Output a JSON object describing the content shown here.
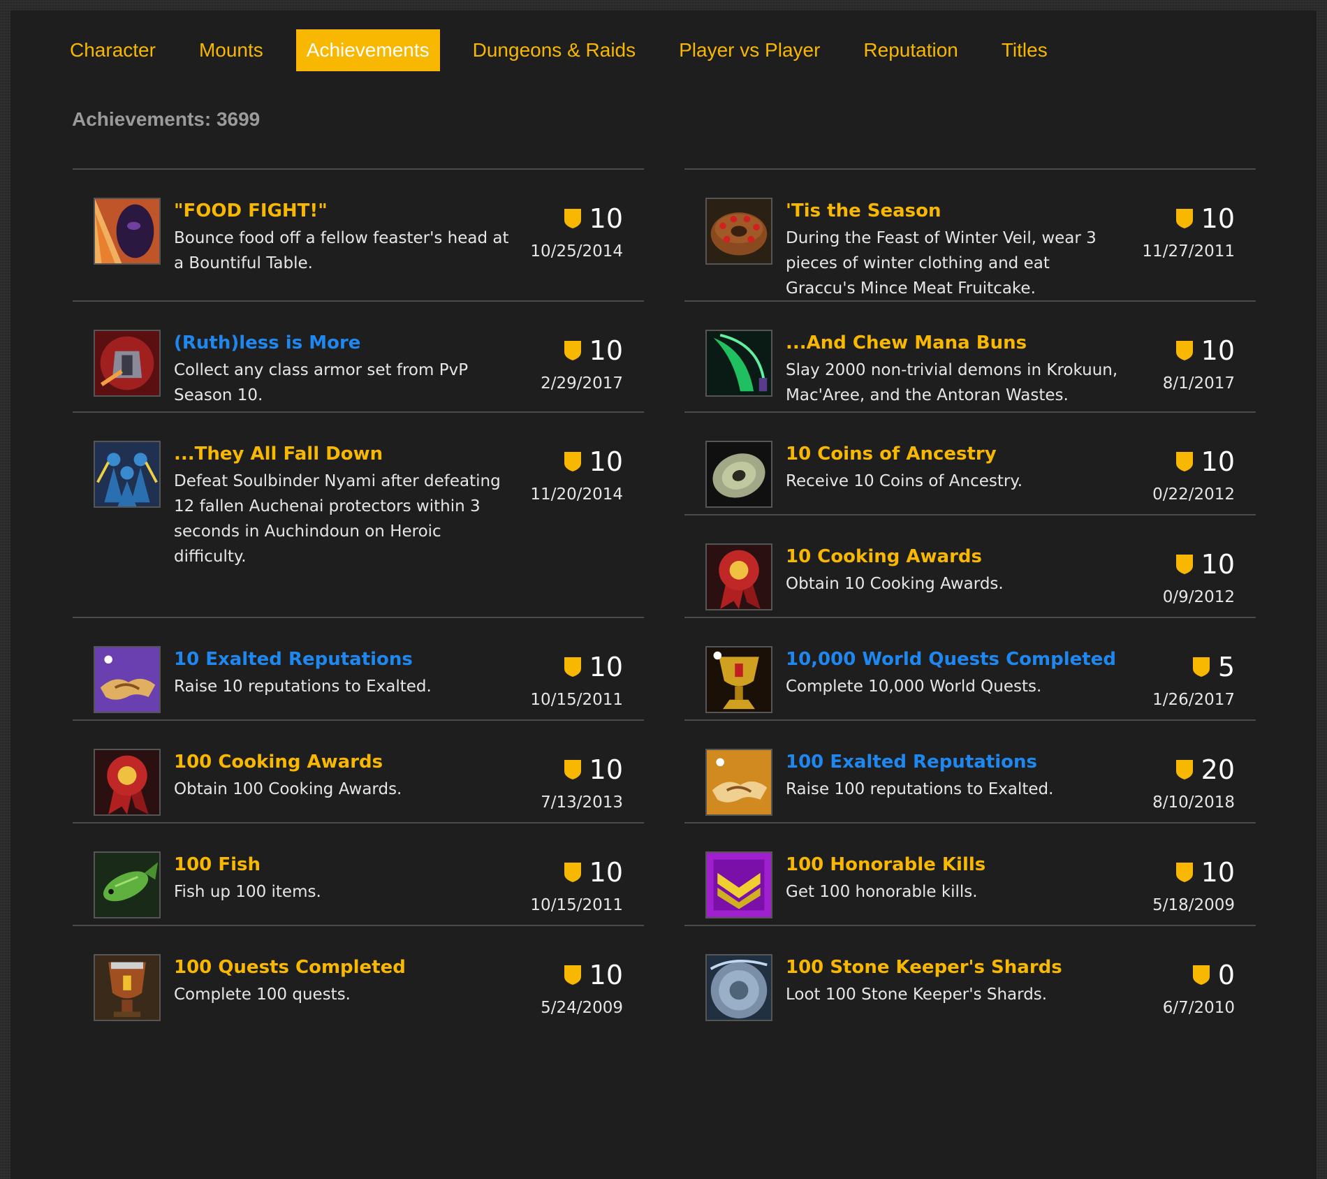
{
  "tabs": [
    {
      "label": "Character",
      "active": false
    },
    {
      "label": "Mounts",
      "active": false
    },
    {
      "label": "Achievements",
      "active": true
    },
    {
      "label": "Dungeons & Raids",
      "active": false
    },
    {
      "label": "Player vs Player",
      "active": false
    },
    {
      "label": "Reputation",
      "active": false
    },
    {
      "label": "Titles",
      "active": false
    }
  ],
  "achievement_count_label": "Achievements: 3699",
  "colors": {
    "gold": "#f8b700",
    "link_blue": "#1e88f0",
    "panel": "#1e1e1e"
  },
  "left": [
    {
      "title": "\"FOOD FIGHT!\"",
      "title_color": "gold",
      "desc": "Bounce food off a fellow feaster's head at a Bountiful Table.",
      "points": "10",
      "date": "10/25/2014",
      "icon": "food-fight-icon"
    },
    {
      "title": "(Ruth)less is More",
      "title_color": "blue",
      "desc": "Collect any class armor set from PvP Season 10.",
      "points": "10",
      "date": "2/29/2017",
      "icon": "armor-set-icon"
    },
    {
      "title": "...They All Fall Down",
      "title_color": "gold",
      "desc": "Defeat Soulbinder Nyami after defeating 12 fallen Auchenai protectors within 3 seconds in Auchindoun on Heroic difficulty.",
      "points": "10",
      "date": "11/20/2014",
      "icon": "figures-icon"
    },
    {
      "title": "10 Exalted Reputations",
      "title_color": "blue",
      "desc": "Raise 10 reputations to Exalted.",
      "points": "10",
      "date": "10/15/2011",
      "icon": "handshake-purple-icon"
    },
    {
      "title": "100 Cooking Awards",
      "title_color": "gold",
      "desc": "Obtain 100 Cooking Awards.",
      "points": "10",
      "date": "7/13/2013",
      "icon": "ribbon-icon"
    },
    {
      "title": "100 Fish",
      "title_color": "gold",
      "desc": "Fish up 100 items.",
      "points": "10",
      "date": "10/15/2011",
      "icon": "fish-icon"
    },
    {
      "title": "100 Quests Completed",
      "title_color": "gold",
      "desc": "Complete 100 quests.",
      "points": "10",
      "date": "5/24/2009",
      "icon": "goblet-icon"
    }
  ],
  "right": [
    {
      "title": "'Tis the Season",
      "title_color": "gold",
      "desc": "During the Feast of Winter Veil, wear 3 pieces of winter clothing and eat Graccu's Mince Meat Fruitcake.",
      "points": "10",
      "date": "11/27/2011",
      "icon": "fruitcake-icon"
    },
    {
      "title": "...And Chew Mana Buns",
      "title_color": "gold",
      "desc": "Slay 2000 non-trivial demons in Krokuun, Mac'Aree, and the Antoran Wastes.",
      "points": "10",
      "date": "8/1/2017",
      "icon": "green-blade-icon"
    },
    {
      "title": "10 Coins of Ancestry",
      "title_color": "gold",
      "desc": "Receive 10 Coins of Ancestry.",
      "points": "10",
      "date": "0/22/2012",
      "icon": "coin-icon"
    },
    {
      "title": "10 Cooking Awards",
      "title_color": "gold",
      "desc": "Obtain 10 Cooking Awards.",
      "points": "10",
      "date": "0/9/2012",
      "icon": "ribbon-icon"
    },
    {
      "title": "10,000 World Quests Completed",
      "title_color": "blue",
      "desc": "Complete 10,000 World Quests.",
      "points": "5",
      "date": "1/26/2017",
      "icon": "chalice-icon"
    },
    {
      "title": "100 Exalted Reputations",
      "title_color": "blue",
      "desc": "Raise 100 reputations to Exalted.",
      "points": "20",
      "date": "8/10/2018",
      "icon": "handshake-gold-icon"
    },
    {
      "title": "100 Honorable Kills",
      "title_color": "gold",
      "desc": "Get 100 honorable kills.",
      "points": "10",
      "date": "5/18/2009",
      "icon": "chevron-rank-icon"
    },
    {
      "title": "100 Stone Keeper's Shards",
      "title_color": "gold",
      "desc": "Loot 100 Stone Keeper's Shards.",
      "points": "0",
      "date": "6/7/2010",
      "icon": "stone-shard-icon"
    }
  ]
}
